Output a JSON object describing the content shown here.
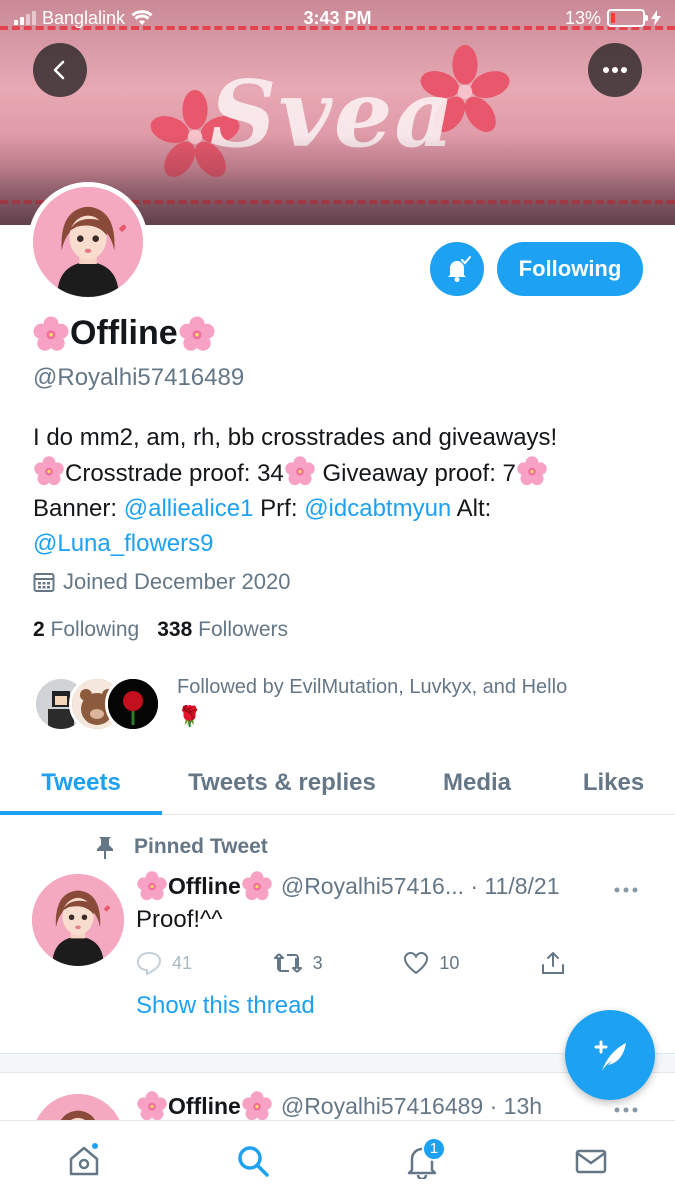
{
  "status_bar": {
    "carrier": "Banglalink",
    "time": "3:43 PM",
    "battery_percent": "13%",
    "battery_level": 0.13
  },
  "banner": {
    "script_text": "Svea",
    "colors": {
      "accent_dash": "#e3424f",
      "flower": "#e8576b"
    }
  },
  "header_buttons": {
    "back_icon": "chevron-left-icon",
    "more_icon": "more-horizontal-icon"
  },
  "profile": {
    "display_name": "Offline",
    "name_emoji": "cherry-blossom",
    "handle": "@Royalhi57416489",
    "bio": {
      "line1": "I do mm2, am, rh, bb crosstrades and giveaways!",
      "crosstrade": "Crosstrade proof: 34",
      "giveaway": "Giveaway proof: 7",
      "banner_label": "Banner:",
      "banner_link": "@alliealice1",
      "prf_label": "Prf:",
      "prf_link": "@idcabtmyun",
      "alt_label": "Alt:",
      "alt_link": "@Luna_flowers9"
    },
    "joined": "Joined December 2020",
    "following_count": "2",
    "following_label": "Following",
    "followers_count": "338",
    "followers_label": "Followers",
    "followed_by": "Followed by EvilMutation, Luvkyx, and Hello",
    "followed_by_emoji": "🌹"
  },
  "actions": {
    "follow_button": "Following"
  },
  "tabs": [
    {
      "label": "Tweets",
      "active": true
    },
    {
      "label": "Tweets & replies",
      "active": false
    },
    {
      "label": "Media",
      "active": false
    },
    {
      "label": "Likes",
      "active": false
    }
  ],
  "tweets": [
    {
      "pinned_label": "Pinned Tweet",
      "name": "Offline",
      "handle_date": "@Royalhi57416... · 11/8/21",
      "text": "Proof!^^",
      "replies": "41",
      "retweets": "3",
      "likes": "10",
      "show_thread": "Show this thread"
    },
    {
      "name": "Offline",
      "handle_date": "@Royalhi57416489 · 13h"
    }
  ],
  "bottom_nav": {
    "notifications_badge": "1"
  },
  "colors": {
    "twitter_blue": "#1da1f2",
    "secondary_text": "#657786"
  }
}
